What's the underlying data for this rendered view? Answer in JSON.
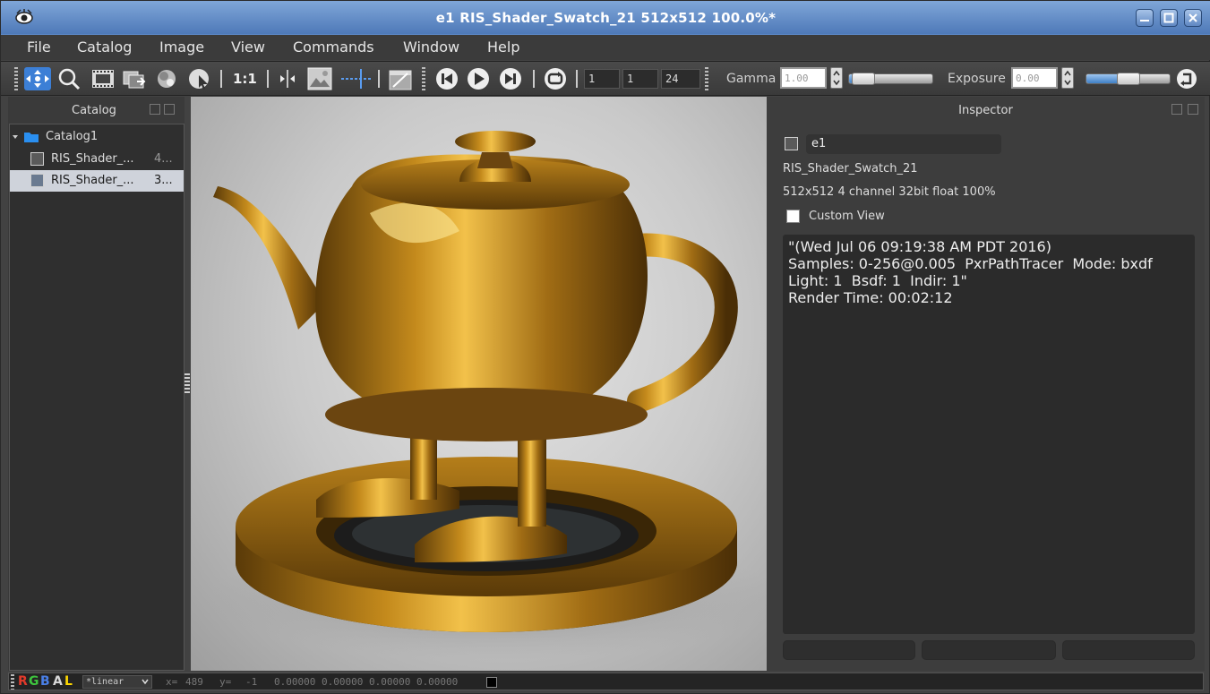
{
  "window": {
    "title": "e1 RIS_Shader_Swatch_21 512x512 100.0%*",
    "accent_color": "#5b86c4"
  },
  "menubar": {
    "items": [
      "File",
      "Catalog",
      "Image",
      "View",
      "Commands",
      "Window",
      "Help"
    ]
  },
  "toolbar": {
    "icons": [
      "pan-icon",
      "zoom-icon",
      "film-strip-icon",
      "layers-icon",
      "compare-icon",
      "pick-icon",
      "one-to-one-label",
      "split-icon",
      "image-icon",
      "crop-line-icon",
      "clapper-icon",
      "skip-back-icon",
      "play-icon",
      "skip-forward-icon",
      "loop-icon"
    ],
    "one_to_one": "1:1",
    "frame_start": "1",
    "frame_current": "1",
    "frame_end": "24",
    "gamma_label": "Gamma",
    "gamma_value": "1.00",
    "gamma_level": 0.05,
    "exposure_label": "Exposure",
    "exposure_value": "0.00",
    "exposure_level": 0.5
  },
  "catalog": {
    "header": "Catalog",
    "root": "Catalog1",
    "items": [
      {
        "label": "RIS_Shader_...",
        "info": "4..."
      },
      {
        "label": "RIS_Shader_...",
        "info": "3..."
      }
    ]
  },
  "inspector": {
    "header": "Inspector",
    "name": "e1",
    "image_name": "RIS_Shader_Swatch_21",
    "image_info": "512x512 4 channel 32bit float 100%",
    "custom_view_label": "Custom View",
    "custom_view_checked": false,
    "metadata": "\"(Wed Jul 06 09:19:38 AM PDT 2016)\nSamples: 0-256@0.005  PxrPathTracer  Mode: bxdf\nLight: 1  Bsdf: 1  Indir: 1\"\nRender Time: 00:02:12"
  },
  "statusbar": {
    "channels": [
      "R",
      "G",
      "B",
      "A",
      "L"
    ],
    "channel_colors": [
      "#e23a2a",
      "#3ec43e",
      "#4a7fe6",
      "#d8d8d8",
      "#ffd800"
    ],
    "lut": "*linear",
    "x_label": "x=",
    "x_value": "489",
    "y_label": "y=",
    "y_value": "-1",
    "pixel_values": "0.00000 0.00000 0.00000 0.00000"
  }
}
